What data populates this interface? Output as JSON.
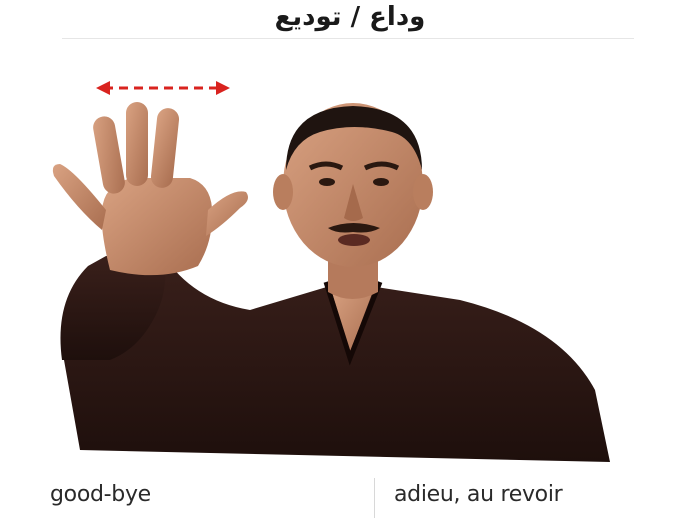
{
  "header": {
    "title": "وداع / توديع"
  },
  "illustration": {
    "subject": "signer-photo",
    "arrow_color": "#d9231f",
    "sweater_color": "#2a1714",
    "skin_color": "#c98f6f"
  },
  "captions": {
    "english": "good-bye",
    "french": "adieu, au revoir"
  }
}
